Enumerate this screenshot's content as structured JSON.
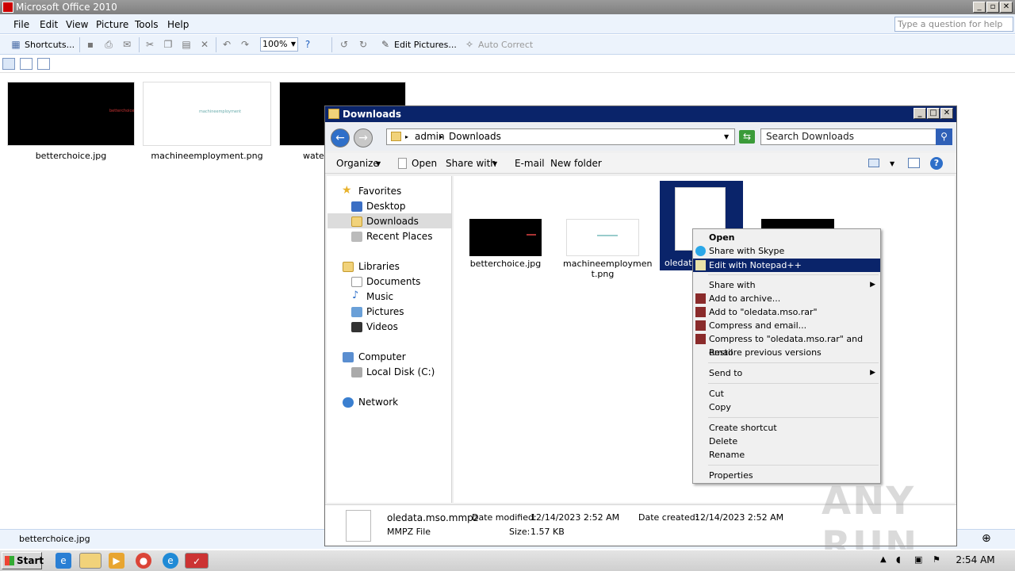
{
  "office": {
    "title": "Microsoft Office 2010",
    "menu": [
      "File",
      "Edit",
      "View",
      "Picture",
      "Tools",
      "Help"
    ],
    "help_placeholder": "Type a question for help",
    "toolbar": {
      "shortcuts": "Shortcuts...",
      "zoom": "100%",
      "edit_pictures": "Edit Pictures...",
      "auto_correct": "Auto Correct"
    },
    "thumbnails": [
      {
        "caption": "betterchoice.jpg",
        "inner_text": "betterchoice"
      },
      {
        "caption": "machineemployment.png",
        "inner_text": "machineemployment"
      },
      {
        "caption": "water"
      }
    ],
    "status_file": "betterchoice.jpg"
  },
  "explorer": {
    "title": "Downloads",
    "breadcrumb": [
      "admin",
      "Downloads"
    ],
    "search_placeholder": "Search Downloads",
    "commands": {
      "organize": "Organize",
      "open": "Open",
      "share_with": "Share with",
      "email": "E-mail",
      "new_folder": "New folder"
    },
    "nav": {
      "favorites": "Favorites",
      "desktop": "Desktop",
      "downloads": "Downloads",
      "recent_places": "Recent Places",
      "libraries": "Libraries",
      "documents": "Documents",
      "music": "Music",
      "pictures": "Pictures",
      "videos": "Videos",
      "computer": "Computer",
      "local_disk": "Local Disk (C:)",
      "network": "Network"
    },
    "files": [
      {
        "name": "betterchoice.jpg"
      },
      {
        "name_line1": "machineemploymen",
        "name_line2": "t.png"
      },
      {
        "name": "oledata"
      }
    ],
    "details": {
      "file_name": "oledata.mso.mmpz",
      "file_type": "MMPZ File",
      "date_modified_label": "Date modified:",
      "date_modified": "12/14/2023 2:52 AM",
      "size_label": "Size:",
      "size": "1.57 KB",
      "date_created_label": "Date created:",
      "date_created": "12/14/2023 2:52 AM"
    }
  },
  "context_menu": {
    "open": "Open",
    "share_skype": "Share with Skype",
    "edit_npp": "Edit with Notepad++",
    "share_with": "Share with",
    "add_archive": "Add to archive...",
    "add_rar": "Add to \"oledata.mso.rar\"",
    "compress_email": "Compress and email...",
    "compress_rar_email": "Compress to \"oledata.mso.rar\" and email",
    "restore": "Restore previous versions",
    "send_to": "Send to",
    "cut": "Cut",
    "copy": "Copy",
    "create_shortcut": "Create shortcut",
    "delete": "Delete",
    "rename": "Rename",
    "properties": "Properties"
  },
  "taskbar": {
    "start": "Start",
    "clock": "2:54 AM"
  },
  "watermark": "ANY RUN"
}
